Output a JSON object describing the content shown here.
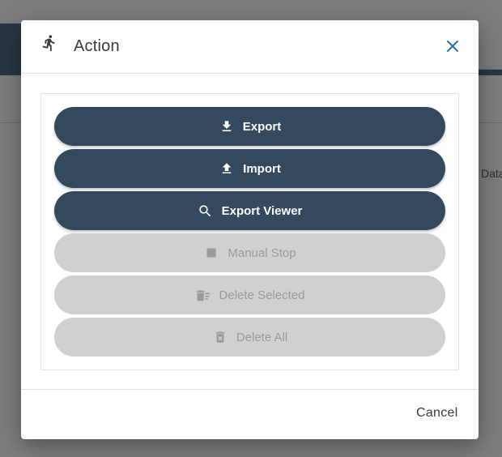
{
  "background": {
    "tab_fragment": "Data"
  },
  "dialog": {
    "title": "Action",
    "title_icon": "run-icon",
    "close_icon": "close-icon",
    "buttons": [
      {
        "label": "Export",
        "icon": "download-icon",
        "enabled": true
      },
      {
        "label": "Import",
        "icon": "upload-icon",
        "enabled": true
      },
      {
        "label": "Export Viewer",
        "icon": "search-icon",
        "enabled": true
      },
      {
        "label": "Manual Stop",
        "icon": "stop-icon",
        "enabled": false
      },
      {
        "label": "Delete Selected",
        "icon": "delete-sweep-icon",
        "enabled": false
      },
      {
        "label": "Delete All",
        "icon": "delete-forever-icon",
        "enabled": false
      }
    ],
    "cancel_label": "Cancel"
  },
  "colors": {
    "primary": "#34495e",
    "disabled": "#d0d0d0",
    "disabled_text": "#9a9a9a",
    "close_icon": "#2a6fb5"
  }
}
